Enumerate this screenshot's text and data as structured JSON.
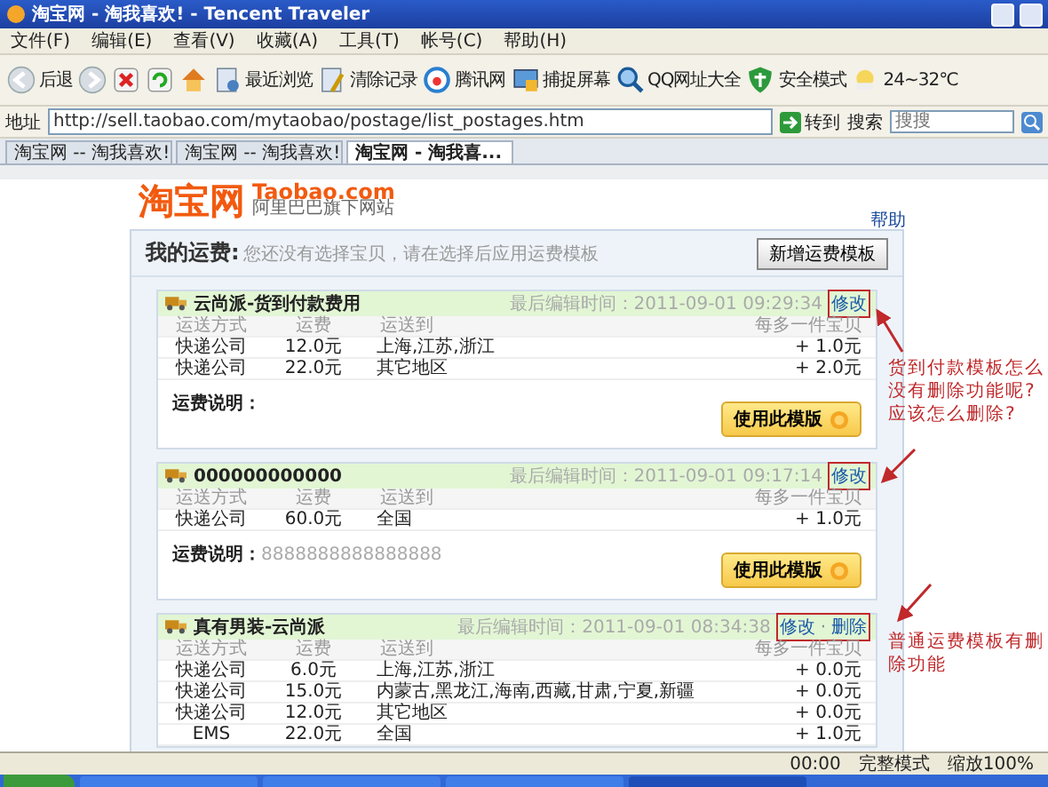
{
  "window": {
    "title": "淘宝网 - 淘我喜欢! - Tencent Traveler"
  },
  "menu": [
    "文件(F)",
    "编辑(E)",
    "查看(V)",
    "收藏(A)",
    "工具(T)",
    "帐号(C)",
    "帮助(H)"
  ],
  "toolbar": [
    {
      "kind": "back",
      "label": "后退"
    },
    {
      "kind": "forward"
    },
    {
      "kind": "stop"
    },
    {
      "kind": "refresh"
    },
    {
      "kind": "home"
    },
    {
      "kind": "recent",
      "label": "最近浏览"
    },
    {
      "kind": "clear",
      "label": "清除记录"
    },
    {
      "kind": "portal",
      "label": "腾讯网"
    },
    {
      "kind": "capture",
      "label": "捕捉屏幕"
    },
    {
      "kind": "search",
      "label": "QQ网址大全"
    },
    {
      "kind": "shield",
      "label": "安全模式"
    },
    {
      "kind": "weather",
      "label": "24~32℃"
    }
  ],
  "address": {
    "label": "地址",
    "value": "http://sell.taobao.com/mytaobao/postage/list_postages.htm",
    "go": "转到",
    "search_label": "搜索",
    "search_placeholder": "搜搜"
  },
  "tabs": [
    {
      "label": "淘宝网 -- 淘我喜欢!",
      "selected": false
    },
    {
      "label": "淘宝网 -- 淘我喜欢!",
      "selected": false
    },
    {
      "label": "淘宝网 - 淘我喜...",
      "selected": true
    }
  ],
  "page": {
    "logo": "淘宝网",
    "logo_en": "Taobao.com",
    "logo_sub": "阿里巴巴旗下网站",
    "help": "帮助",
    "heading": "我的运费:",
    "hint": "您还没有选择宝贝，请在选择后应用运费模板",
    "new_button": "新增运费模板"
  },
  "templates": [
    {
      "columns": [
        "运送方式",
        "运费",
        "运送到",
        "每多一件宝贝"
      ],
      "name": "云尚派-货到付款费用",
      "edited": "最后编辑时间：2011-09-01 09:29:34",
      "actions": [
        "修改"
      ],
      "marked": true,
      "rows": [
        [
          "快递公司",
          "12.0元",
          "上海,江苏,浙江",
          "+ 1.0元"
        ],
        [
          "快递公司",
          "22.0元",
          "其它地区",
          "+ 2.0元"
        ]
      ],
      "note_label": "运费说明：",
      "use_button": "使用此模版"
    },
    {
      "columns": [
        "运送方式",
        "运费",
        "运送到",
        "每多一件宝贝"
      ],
      "name": "000000000000",
      "edited": "最后编辑时间：2011-09-01 09:17:14",
      "actions": [
        "修改"
      ],
      "marked": true,
      "rows": [
        [
          "快递公司",
          "60.0元",
          "全国",
          "+ 1.0元"
        ]
      ],
      "note_label": "运费说明：",
      "note": "8888888888888888",
      "use_button": "使用此模版"
    },
    {
      "columns": [
        "运送方式",
        "运费",
        "运送到",
        "每多一件宝贝"
      ],
      "name": "真有男装-云尚派",
      "edited": "最后编辑时间：2011-09-01 08:34:38",
      "actions": [
        "修改",
        "删除"
      ],
      "separator": "·",
      "marked": true,
      "rows": [
        [
          "快递公司",
          "6.0元",
          "上海,江苏,浙江",
          "+ 0.0元"
        ],
        [
          "快递公司",
          "15.0元",
          "内蒙古,黑龙江,海南,西藏,甘肃,宁夏,新疆",
          "+ 0.0元"
        ],
        [
          "快递公司",
          "12.0元",
          "其它地区",
          "+ 0.0元"
        ],
        [
          "EMS",
          "22.0元",
          "全国",
          "+ 1.0元"
        ]
      ]
    }
  ],
  "annotations": [
    "货到付款模板怎么没有删除功能呢?应该怎么删除?",
    "普通运费模板有删除功能"
  ],
  "status_bar": {
    "time": "00:00",
    "mode": "完整模式",
    "zoom": "缩放100%"
  },
  "taskbar": {
    "tasks": [
      {
        "selected": false
      },
      {
        "selected": false
      },
      {
        "selected": false
      },
      {
        "selected": true
      }
    ]
  }
}
